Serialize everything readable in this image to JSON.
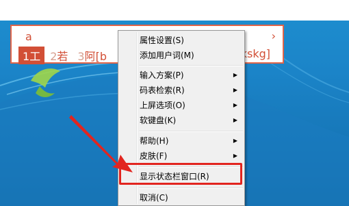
{
  "ime": {
    "input_code": "a",
    "next_page_glyph": "›",
    "candidates": [
      {
        "num": "1",
        "text": "工"
      },
      {
        "num": "2",
        "text": "若"
      },
      {
        "num": "3",
        "text": "阿[b"
      }
    ],
    "tail_text": "kskg]"
  },
  "context_menu": {
    "items": {
      "properties": "属性设置(S)",
      "add_user_word": "添加用户词(M)",
      "input_scheme": "输入方案(P)",
      "code_lookup": "码表检索(R)",
      "screen_options": "上屏选项(O)",
      "soft_keyboard": "软键盘(K)",
      "help": "帮助(H)",
      "skin": "皮肤(F)",
      "show_status_bar": "显示状态栏窗口(R)",
      "cancel": "取消(C)"
    },
    "submenu_glyph": "▶"
  },
  "colors": {
    "ime_accent": "#d24f36",
    "highlight_box": "#e2251f",
    "desktop_blue": "#1b84c8",
    "menu_bg": "#f0f0f0"
  }
}
